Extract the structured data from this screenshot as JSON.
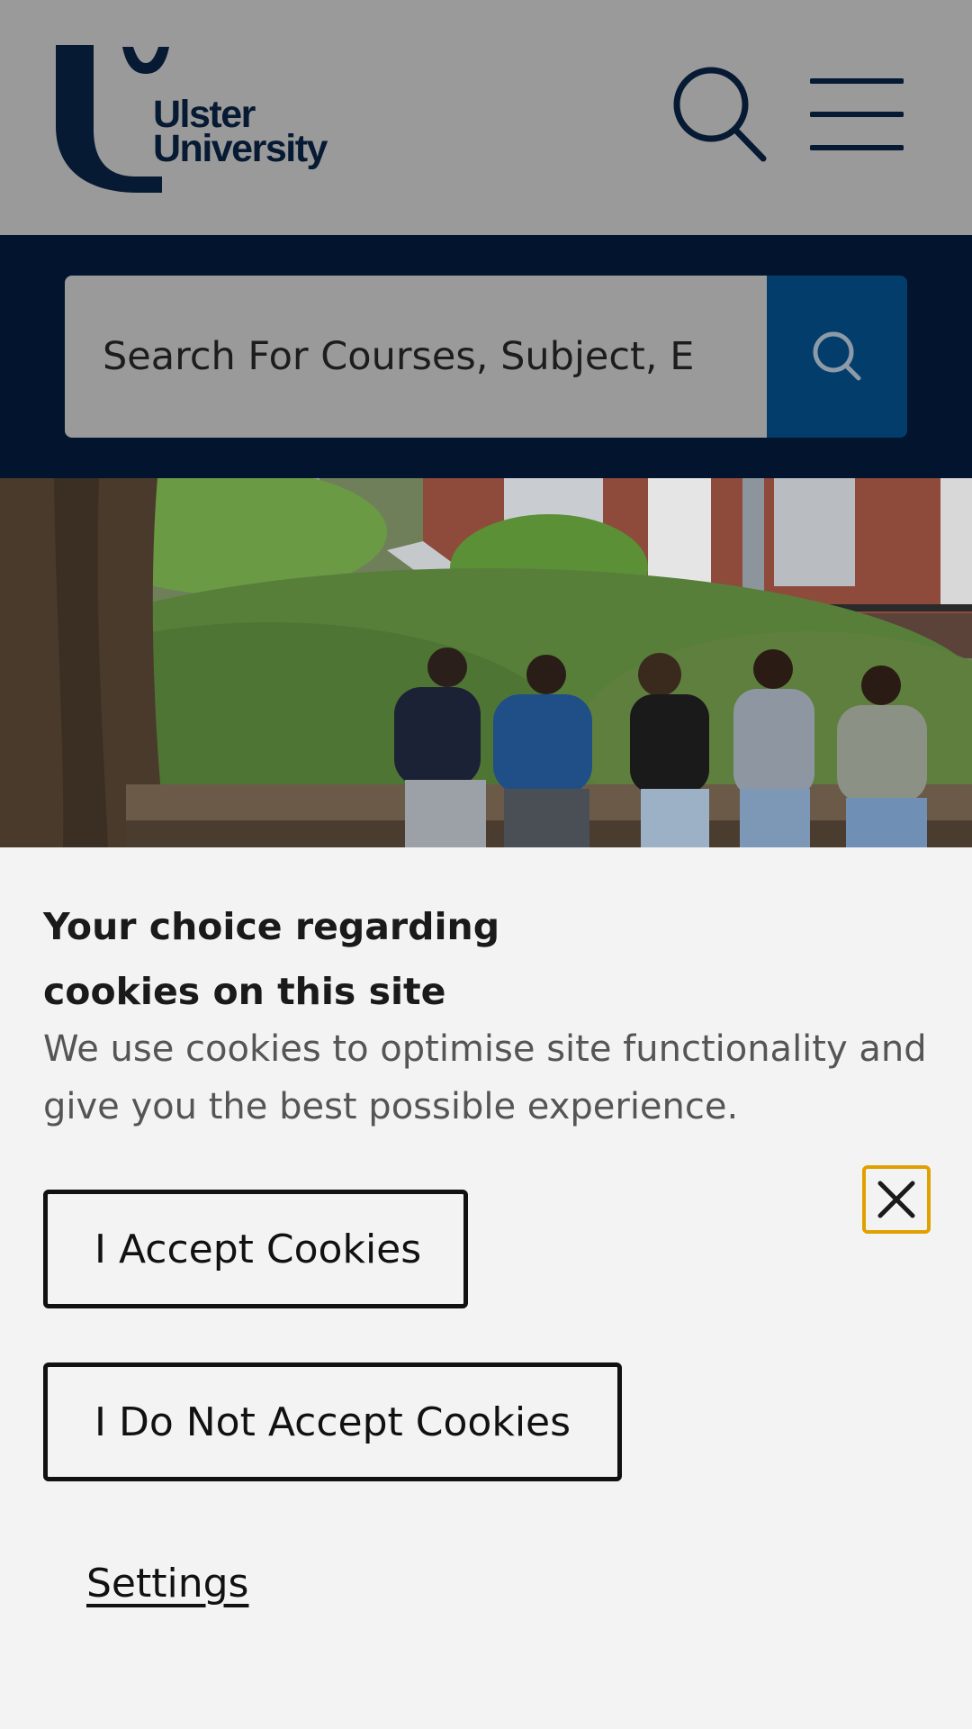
{
  "header": {
    "logo_line1": "Ulster",
    "logo_line2": "University",
    "search_icon": "search-icon",
    "menu_icon": "hamburger-menu-icon"
  },
  "search": {
    "placeholder": "Search For Courses, Subject, E",
    "submit_icon": "search-icon"
  },
  "hero": {
    "image": "students-sitting-on-bench-photo"
  },
  "cookie_banner": {
    "title": "Your choice regarding cookies on this site",
    "description": "We use cookies to optimise site functionality and give you the best possible experience.",
    "accept_label": "I Accept Cookies",
    "decline_label": "I Do Not Accept Cookies",
    "settings_label": "Settings",
    "close_icon": "close-icon"
  },
  "colors": {
    "header_bg": "#9a9a9a",
    "brand_navy": "#03142f",
    "search_button": "#033d6b",
    "focus_outline": "#e0a100",
    "panel_bg": "#f3f3f3"
  }
}
